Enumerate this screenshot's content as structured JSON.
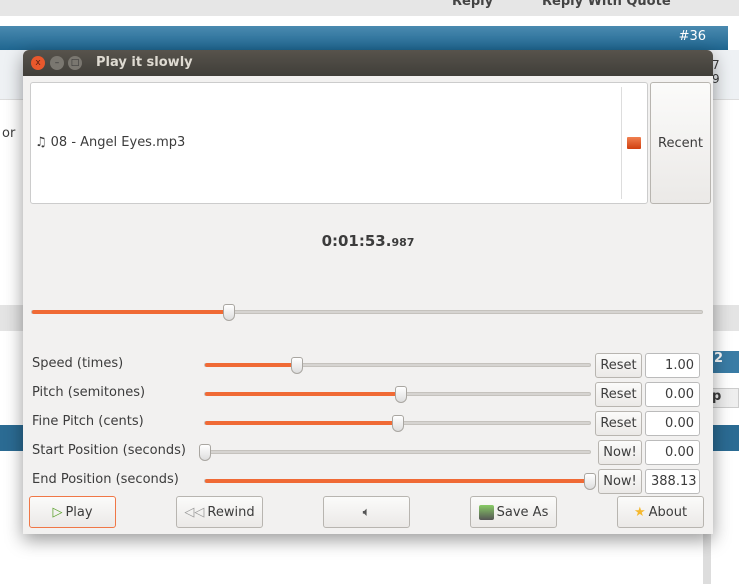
{
  "background": {
    "reply": "Reply",
    "reply_quote": "Reply With Quote",
    "post_number": "#36",
    "side_text_left": "or",
    "side_text_right_1": "7",
    "side_text_right_2": "9",
    "side_badge": "2",
    "side_button": "p"
  },
  "window": {
    "title": "Play it slowly"
  },
  "file": {
    "name": "08 - Angel Eyes.mp3",
    "recent_label": "Recent"
  },
  "position": {
    "time_main": "0:01:53.",
    "time_ms": "987",
    "percent": 29.4
  },
  "controls": [
    {
      "label": "Speed (times)",
      "button": "Reset",
      "value": "1.00",
      "percent": 24
    },
    {
      "label": "Pitch (semitones)",
      "button": "Reset",
      "value": "0.00",
      "percent": 51
    },
    {
      "label": "Fine Pitch (cents)",
      "button": "Reset",
      "value": "0.00",
      "percent": 50
    },
    {
      "label": "Start Position (seconds)",
      "button": "Now!",
      "value": "0.00",
      "percent": 0
    },
    {
      "label": "End Position (seconds)",
      "button": "Now!",
      "value": "388.13",
      "percent": 100
    }
  ],
  "buttons": {
    "play": "Play",
    "rewind": "Rewind",
    "save_as": "Save As",
    "about": "About"
  },
  "colors": {
    "accent": "#f06a35",
    "titlebar": "#4b4842"
  }
}
